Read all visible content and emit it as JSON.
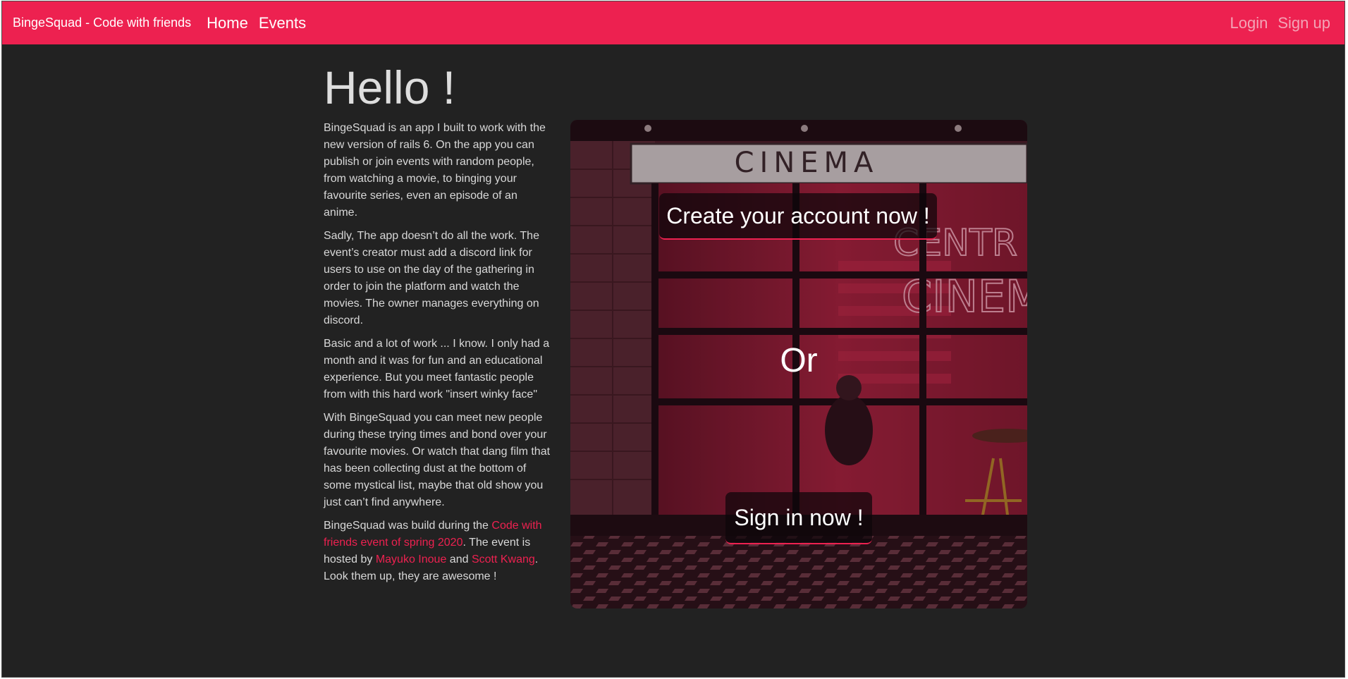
{
  "navbar": {
    "brand": "BingeSquad - Code with friends",
    "links": [
      {
        "label": "Home"
      },
      {
        "label": "Events"
      }
    ],
    "right_links": [
      {
        "label": "Login"
      },
      {
        "label": "Sign up"
      }
    ]
  },
  "main": {
    "heading": "Hello !",
    "paragraphs": [
      "BingeSquad is an app I built to work with the new version of rails 6. On the app you can publish or join events with random people, from watching a movie, to binging your favourite series, even an episode of an anime.",
      "Sadly, The app doesn’t do all the work. The event’s creator must add a discord link for users to use on the day of the gathering in order to join the platform and watch the movies. The owner manages everything on discord.",
      "Basic and a lot of work ... I know. I only had a month and it was for fun and an educational experience. But you meet fantastic people from with this hard work \"insert winky face\"",
      "With BingeSquad you can meet new people during these trying times and bond over your favourite movies. Or watch that dang film that has been collecting dust at the bottom of some mystical list, maybe that old show you just can’t find anywhere."
    ],
    "credits": {
      "text_1": "BingeSquad was build during the ",
      "event_link": "Code with friends event of spring 2020",
      "text_2": ". The event is hosted by ",
      "host_1": "Mayuko Inoue",
      "text_3": " and ",
      "host_2": "Scott Kwang",
      "text_4": ". Look them up, they are awesome !"
    }
  },
  "hero": {
    "sign_text": "CINEMA",
    "neon_text_1": "CENTR",
    "neon_text_2": "CINEM",
    "create_button": "Create your account now !",
    "or_label": "Or",
    "signin_button": "Sign in now !"
  },
  "colors": {
    "accent": "#ed2150",
    "page_background": "#222222",
    "text": "#d8d8d8"
  }
}
